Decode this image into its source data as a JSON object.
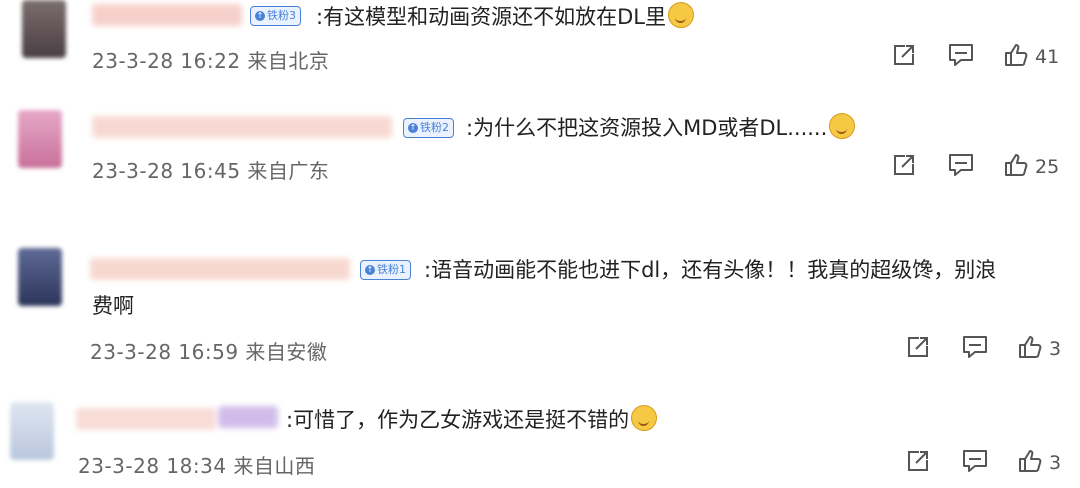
{
  "comments": [
    {
      "text": ":有这模型和动画资源还不如放在DL里",
      "badge": "铁粉3",
      "time": "23-3-28 16:22",
      "location": "来自北京",
      "likes": "41"
    },
    {
      "text": ":为什么不把这资源投入MD或者DL......",
      "badge": "铁粉2",
      "time": "23-3-28 16:45",
      "location": "来自广东",
      "likes": "25"
    },
    {
      "text_line1": ":语音动画能不能也进下dl，还有头像！！我真的超级馋，别浪",
      "text_line2": "费啊",
      "badge": "铁粉1",
      "time": "23-3-28 16:59",
      "location": "来自安徽",
      "likes": "3"
    },
    {
      "text": ":可惜了，作为乙女游戏还是挺不错的",
      "time": "23-3-28 18:34",
      "location": "来自山西",
      "likes": "3"
    }
  ],
  "icons": {
    "share": "share-icon",
    "reply": "comment-icon",
    "like": "thumbs-up-icon"
  },
  "colors": {
    "badge": "#4a82d6",
    "text": "#222222",
    "meta": "#666666"
  }
}
